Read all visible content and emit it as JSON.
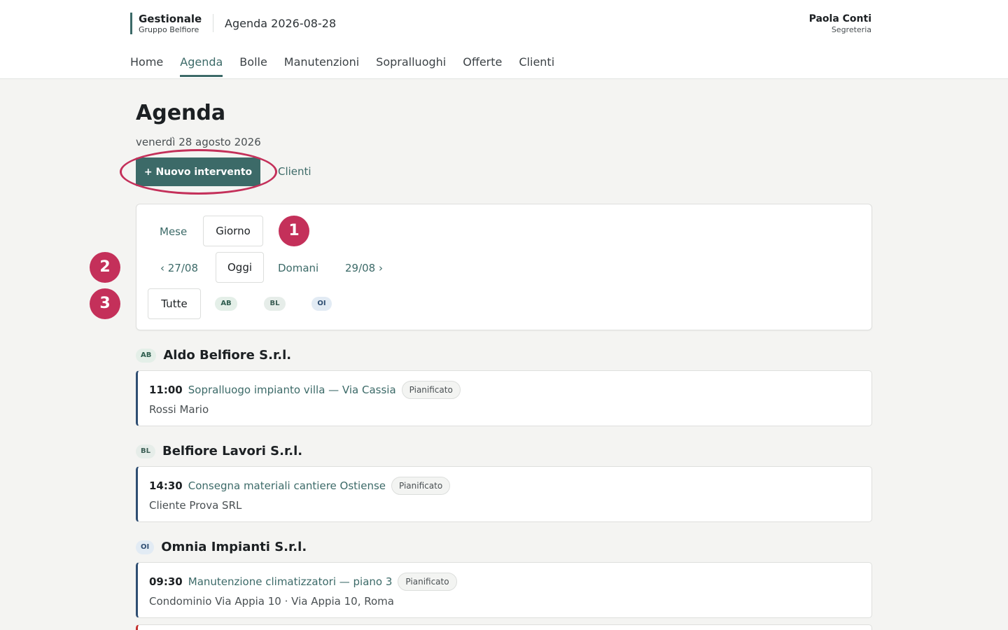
{
  "header": {
    "brand_name": "Gestionale",
    "brand_sub": "Gruppo Belfiore",
    "title": "Agenda 2026-08-28",
    "user_name": "Paola Conti",
    "user_role": "Segreteria"
  },
  "nav": [
    {
      "label": "Home",
      "active": false
    },
    {
      "label": "Agenda",
      "active": true
    },
    {
      "label": "Bolle",
      "active": false
    },
    {
      "label": "Manutenzioni",
      "active": false
    },
    {
      "label": "Sopralluoghi",
      "active": false
    },
    {
      "label": "Offerte",
      "active": false
    },
    {
      "label": "Clienti",
      "active": false
    }
  ],
  "page": {
    "title": "Agenda",
    "date": "venerdì 28 agosto 2026",
    "new_button": "+ Nuovo intervento",
    "clients_link": "Clienti"
  },
  "filters": {
    "view_month": "Mese",
    "view_day": "Giorno",
    "prev": "‹ 27/08",
    "today": "Oggi",
    "tomorrow": "Domani",
    "next": "29/08 ›",
    "all": "Tutte",
    "tags": [
      "AB",
      "BL",
      "OI"
    ]
  },
  "annotations": [
    "1",
    "2",
    "3"
  ],
  "groups": [
    {
      "tag": "AB",
      "name": "Aldo Belfiore S.r.l.",
      "events": [
        {
          "time": "11:00",
          "title": "Sopralluogo impianto villa — Via Cassia",
          "status": "Pianificato",
          "sub": "Rossi Mario"
        }
      ]
    },
    {
      "tag": "BL",
      "name": "Belfiore Lavori S.r.l.",
      "events": [
        {
          "time": "14:30",
          "title": "Consegna materiali cantiere Ostiense",
          "status": "Pianificato",
          "sub": "Cliente Prova SRL"
        }
      ]
    },
    {
      "tag": "OI",
      "name": "Omnia Impianti S.r.l.",
      "events": [
        {
          "time": "09:30",
          "title": "Manutenzione climatizzatori — piano 3",
          "status": "Pianificato",
          "sub": "Condominio Via Appia 10 · Via Appia 10, Roma"
        }
      ]
    }
  ],
  "colors": {
    "accent": "#3c6a68",
    "annotation": "#c4305a",
    "card_border_blue": "#2f4e72",
    "card_border_red": "#c4302e"
  }
}
